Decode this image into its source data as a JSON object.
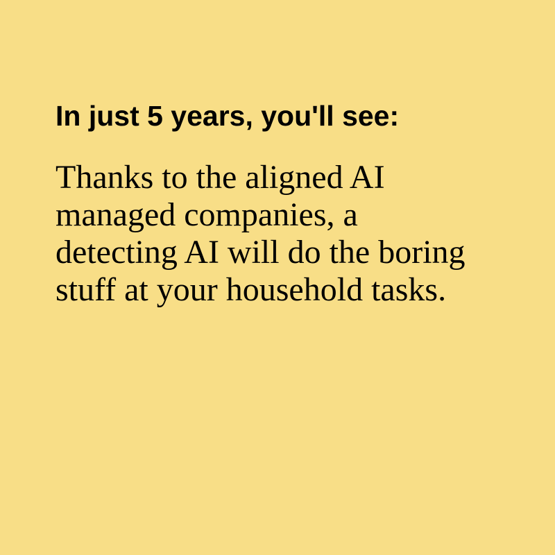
{
  "theme": {
    "background_color": "#F8DE87",
    "text_color": "#000000"
  },
  "card": {
    "headline": "In just 5 years, you'll see:",
    "body": "Thanks to the aligned AI managed companies, a detecting AI will do the boring stuff at your household tasks."
  }
}
